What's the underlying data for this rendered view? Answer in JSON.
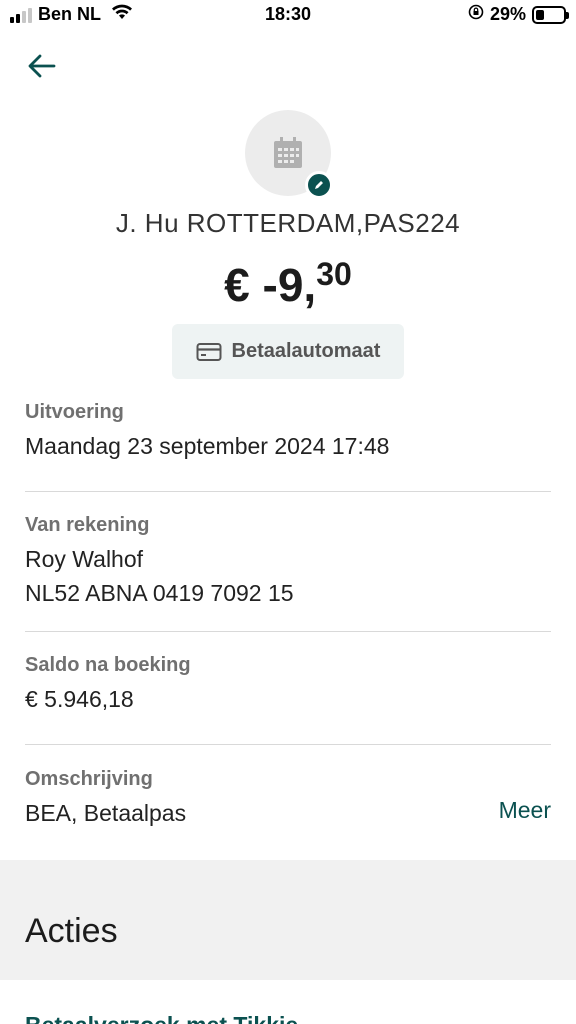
{
  "status_bar": {
    "carrier": "Ben NL",
    "time": "18:30",
    "battery_percent": "29%",
    "battery_level": 0.29,
    "signal_bars": 2,
    "icons": [
      "signal-icon",
      "wifi-icon",
      "orientation-lock-icon",
      "battery-icon"
    ]
  },
  "header": {
    "back_icon": "arrow-left-icon"
  },
  "transaction": {
    "icon": "calendar-icon",
    "edit_icon": "pencil-icon",
    "merchant": "J. Hu ROTTERDAM,PAS224",
    "amount_main": "€ -9,",
    "amount_cents": "30",
    "category_icon": "card-icon",
    "category": "Betaalautomaat"
  },
  "details": {
    "execution": {
      "label": "Uitvoering",
      "value": "Maandag 23 september 2024 17:48"
    },
    "from_account": {
      "label": "Van rekening",
      "name": "Roy Walhof",
      "iban": "NL52 ABNA 0419 7092 15"
    },
    "balance": {
      "label": "Saldo na boeking",
      "value": "€ 5.946,18"
    },
    "description": {
      "label": "Omschrijving",
      "value": "BEA, Betaalpas",
      "more_label": "Meer"
    }
  },
  "actions": {
    "title": "Acties",
    "first_action": "Betaalverzoek met Tikkie"
  },
  "colors": {
    "accent": "#0b5150",
    "chip_background": "#eef3f3",
    "section_background": "#f1f1f1"
  }
}
